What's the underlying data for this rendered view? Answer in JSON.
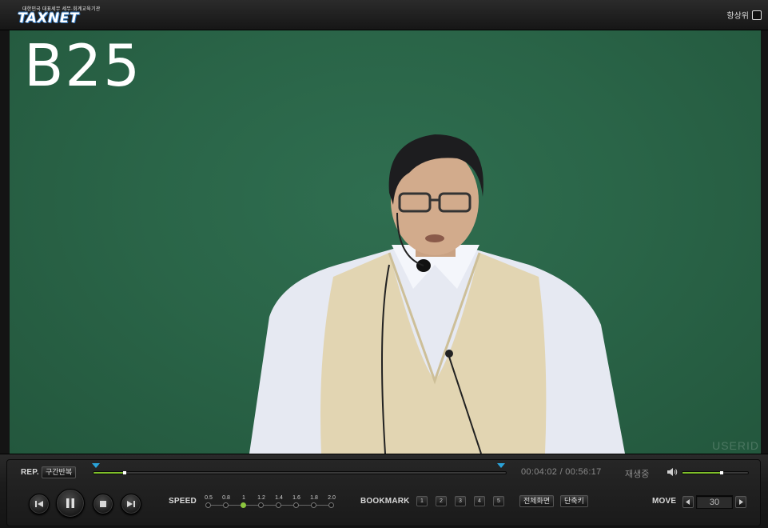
{
  "header": {
    "logo_tagline": "대한민국 대표세무 세무·회계교육기관",
    "logo_text": "TAXNET",
    "always_on_top_label": "항상위",
    "always_on_top_checked": false
  },
  "video": {
    "lecture_code": "B25",
    "watermark": "USERID"
  },
  "controls": {
    "rep_label": "REP.",
    "section_repeat_button": "구간반복",
    "progress_fraction": 0.072,
    "current_time": "00:04:02",
    "time_separator": "/",
    "total_time": "00:56:17",
    "status": "재생중",
    "volume_fraction": 0.57,
    "speed_label": "SPEED",
    "speed_options": [
      "0.5",
      "0.8",
      "1",
      "1.2",
      "1.4",
      "1.6",
      "1.8",
      "2.0"
    ],
    "speed_selected": "1",
    "bookmark_label": "BOOKMARK",
    "bookmarks": [
      "1",
      "2",
      "3",
      "4",
      "5"
    ],
    "fullscreen_button": "전체화면",
    "shortcut_button": "단축키",
    "move_label": "MOVE",
    "move_value": "30",
    "icons": {
      "prev": "skip-back-icon",
      "pause": "pause-icon",
      "stop": "stop-icon",
      "next": "skip-forward-icon",
      "volume": "speaker-icon"
    },
    "accent_color": "#7fbf2a",
    "marker_color": "#2aa3d9"
  }
}
